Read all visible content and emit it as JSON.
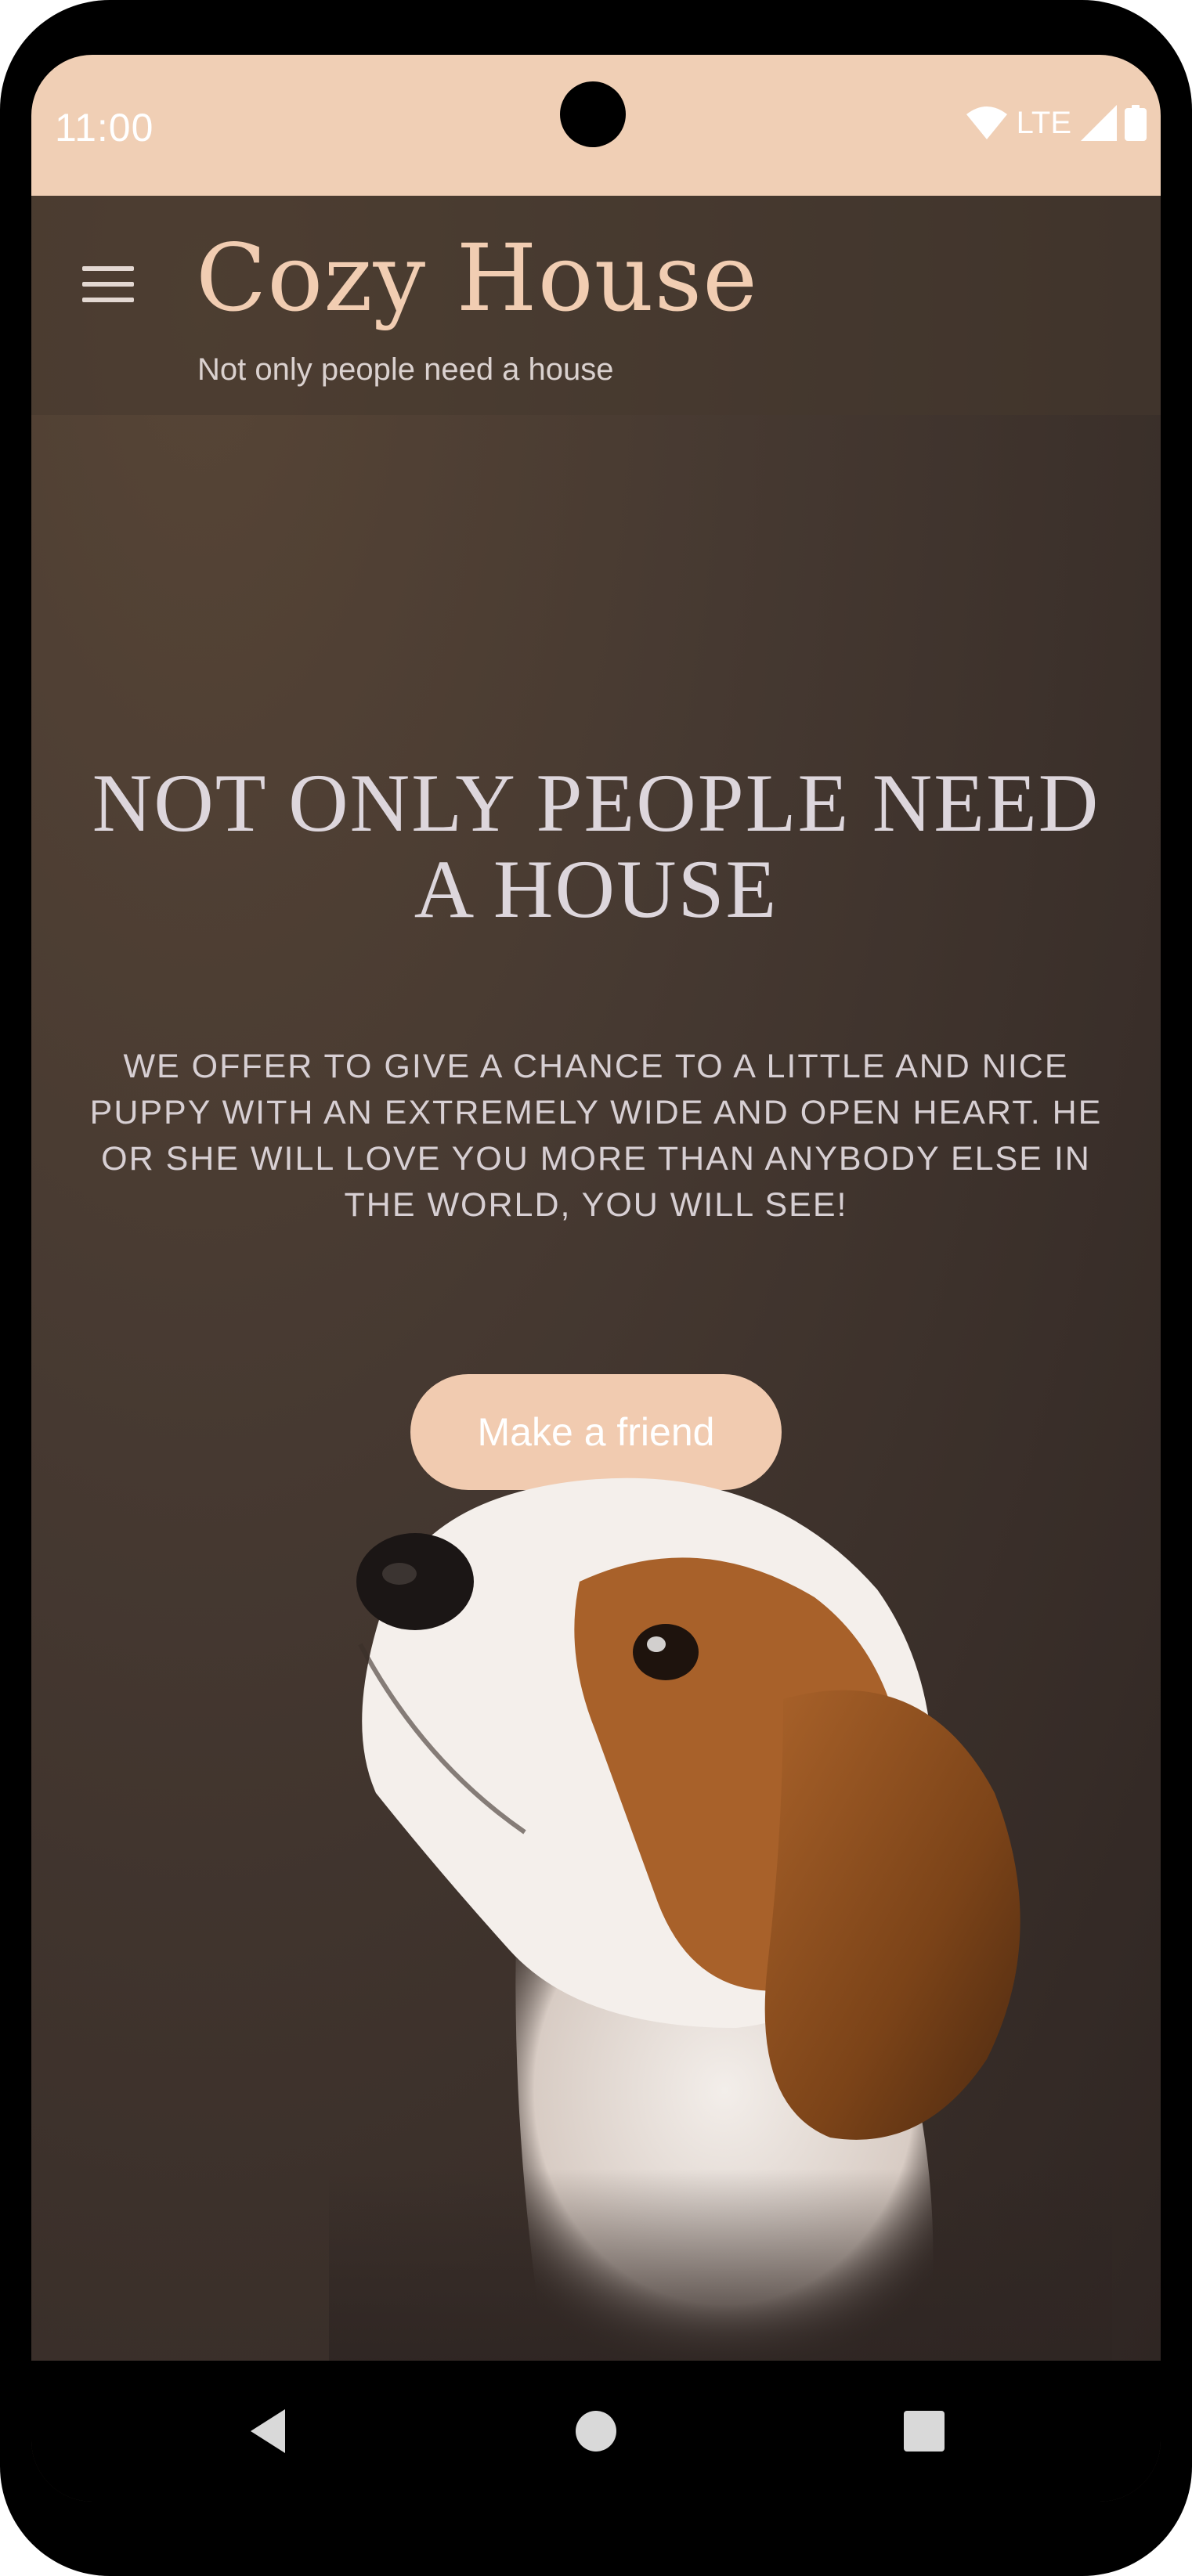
{
  "status_bar": {
    "time": "11:00",
    "network": "LTE",
    "icons": [
      "wifi-icon",
      "signal-icon",
      "battery-icon"
    ]
  },
  "header": {
    "menu_icon": "hamburger-menu-icon",
    "title": "Cozy House",
    "subtitle": "Not only people need a house"
  },
  "hero": {
    "headline": "NOT ONLY PEOPLE NEED A HOUSE",
    "description": "WE OFFER TO GIVE A CHANCE TO A LITTLE AND NICE PUPPY WITH AN EXTREMELY WIDE AND OPEN HEART. HE OR SHE WILL LOVE YOU MORE THAN ANYBODY ELSE IN THE WORLD, YOU WILL SEE!",
    "cta_label": "Make a friend",
    "image": "beagle-puppy"
  },
  "nav_bar": {
    "icons": [
      "back-icon",
      "home-icon",
      "recents-icon"
    ]
  },
  "colors": {
    "accent": "#f0cfb5",
    "background": "#3c302a",
    "title": "#f1cdb2",
    "text": "#ddd6dc"
  }
}
